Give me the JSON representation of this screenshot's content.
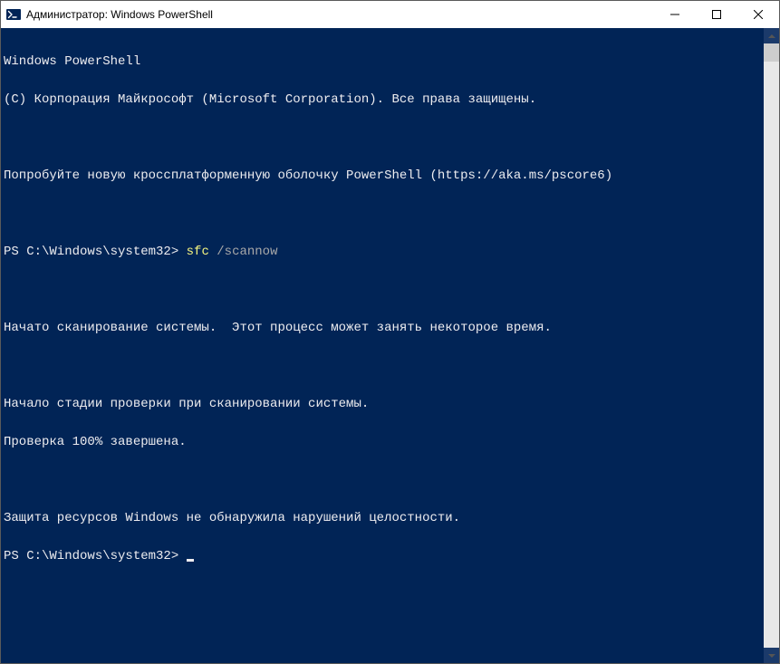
{
  "window": {
    "title": "Администратор: Windows PowerShell"
  },
  "console": {
    "header1": "Windows PowerShell",
    "header2": "(C) Корпорация Майкрософт (Microsoft Corporation). Все права защищены.",
    "promo": "Попробуйте новую кроссплатформенную оболочку PowerShell (https://aka.ms/pscore6)",
    "prompt1_prefix": "PS C:\\Windows\\system32> ",
    "prompt1_cmd": "sfc",
    "prompt1_arg": " /scannow",
    "line_scan_start": "Начато сканирование системы.  Этот процесс может занять некоторое время.",
    "line_stage_start": "Начало стадии проверки при сканировании системы.",
    "line_progress": "Проверка 100% завершена.",
    "line_result": "Защита ресурсов Windows не обнаружила нарушений целостности.",
    "prompt2_prefix": "PS C:\\Windows\\system32> "
  }
}
